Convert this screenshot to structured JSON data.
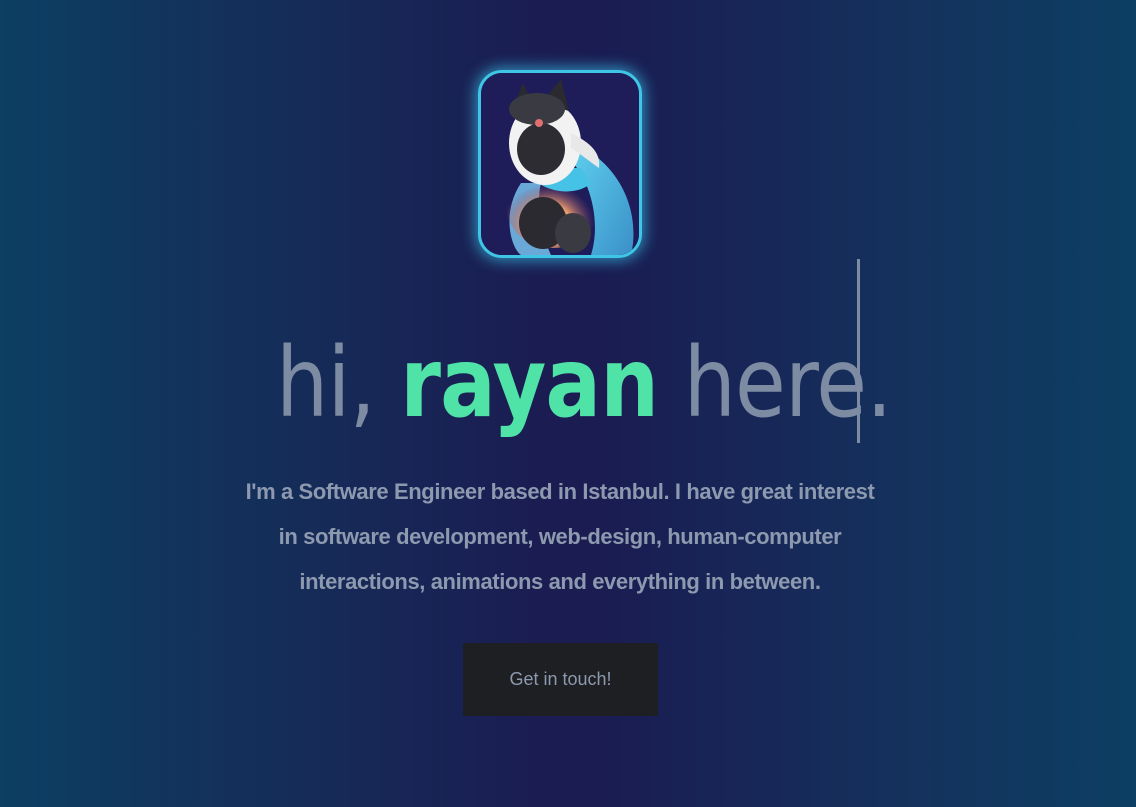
{
  "hero": {
    "greeting_prefix": "hi, ",
    "name": "rayan",
    "greeting_suffix": " here.",
    "bio": "I'm a Software Engineer based in Istanbul. I have great interest in software development, web-design, human-computer interactions, animations and everything in between.",
    "cta_label": "Get in touch!"
  },
  "avatar": {
    "icon": "profile-avatar-character"
  },
  "colors": {
    "accent": "#50e3a8",
    "text_muted": "#7d8ba3",
    "body_text": "#8d99ae",
    "avatar_glow": "#3fc6e6",
    "button_bg": "#1e1f22"
  }
}
